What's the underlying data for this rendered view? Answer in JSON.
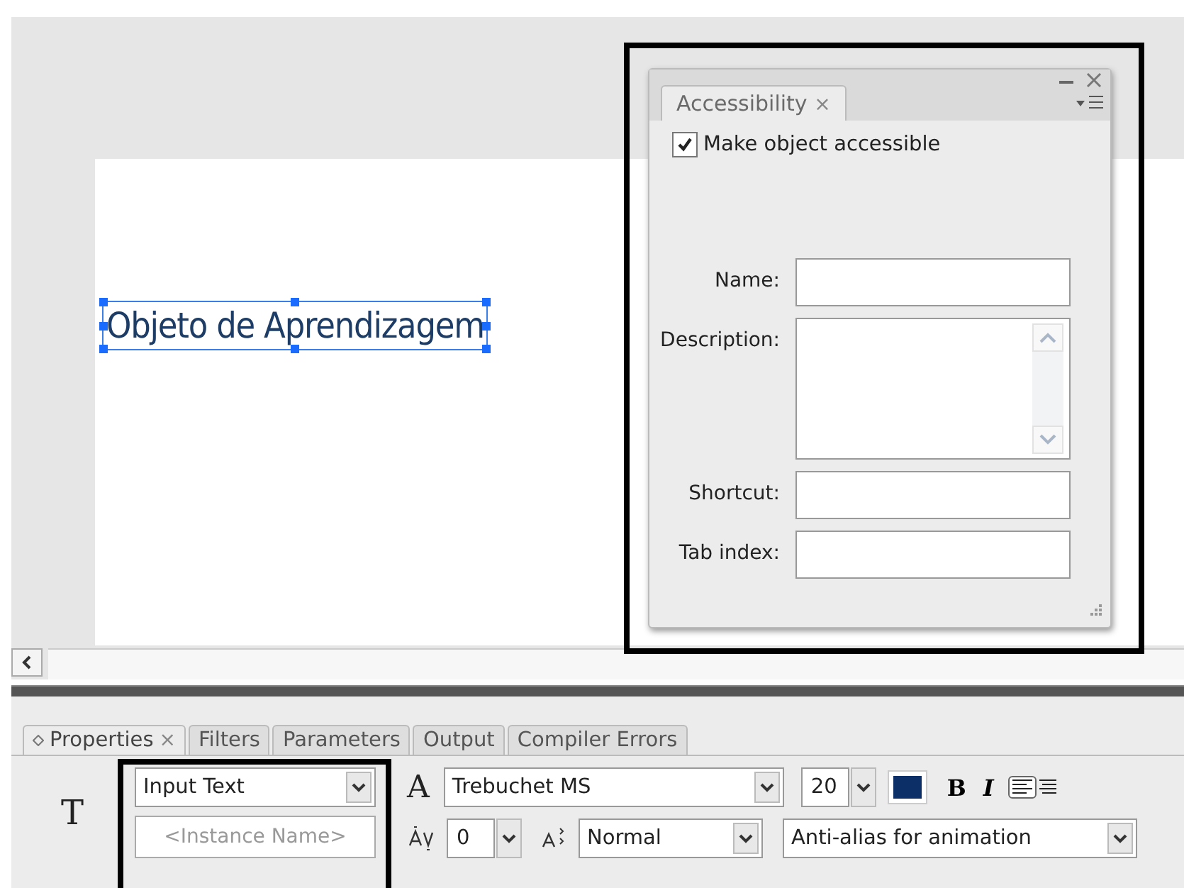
{
  "stage": {
    "text_object": "Objeto de Aprendizagem"
  },
  "accessibility_panel": {
    "tab": "Accessibility",
    "close_tab": "×",
    "make_accessible": {
      "label": "Make object accessible",
      "checked": true
    },
    "fields": [
      {
        "label": "Name:",
        "kind": "line"
      },
      {
        "label": "Description:",
        "kind": "area"
      },
      {
        "label": "Shortcut:",
        "kind": "line"
      },
      {
        "label": "Tab index:",
        "kind": "line"
      }
    ]
  },
  "properties_panel": {
    "tabs": [
      {
        "label": "Properties",
        "close": "×",
        "selected": true
      },
      {
        "label": "Filters",
        "selected": false
      },
      {
        "label": "Parameters",
        "selected": false
      },
      {
        "label": "Output",
        "selected": false
      },
      {
        "label": "Compiler Errors",
        "selected": false
      }
    ],
    "tool_glyph": "T",
    "text_type": "Input Text",
    "instance_name": {
      "placeholder": "<Instance Name>"
    },
    "font_glyph": "A",
    "font": "Trebuchet MS",
    "size": "20",
    "bold": "B",
    "italic": "I",
    "letter_spacing": "0",
    "position": "Normal",
    "anti_alias": "Anti-alias for animation"
  }
}
